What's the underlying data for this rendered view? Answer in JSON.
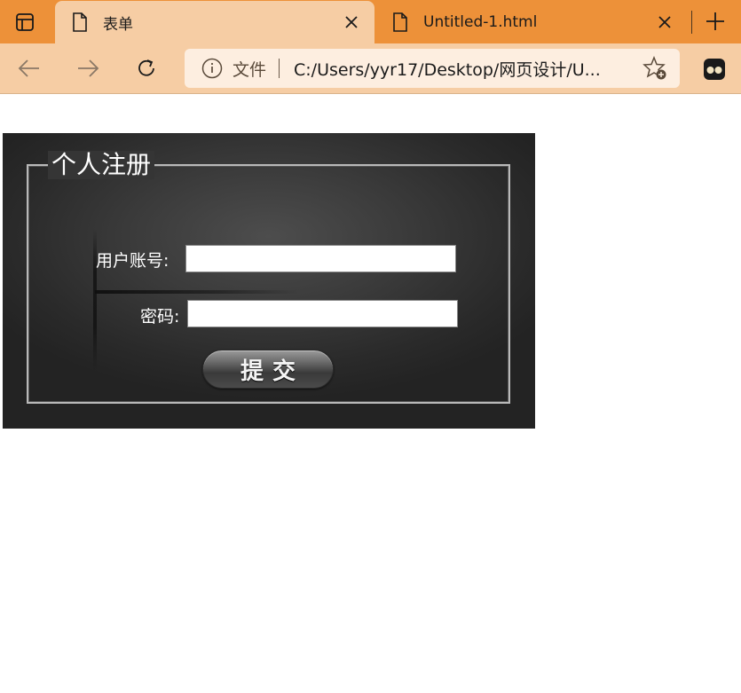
{
  "browser": {
    "tabs": [
      {
        "title": "表单",
        "active": true
      },
      {
        "title": "Untitled-1.html",
        "active": false
      }
    ],
    "address_bar": {
      "scheme_label": "文件",
      "url": "C:/Users/yyr17/Desktop/网页设计/U..."
    },
    "colors": {
      "tabstrip": "#ed9139",
      "toolbar": "#f6cda4",
      "address_bg": "#fdeee0"
    }
  },
  "form": {
    "legend": "个人注册",
    "username_label": "用户账号:",
    "username_value": "",
    "password_label": "密码:",
    "password_value": "",
    "submit_label": "提交"
  }
}
